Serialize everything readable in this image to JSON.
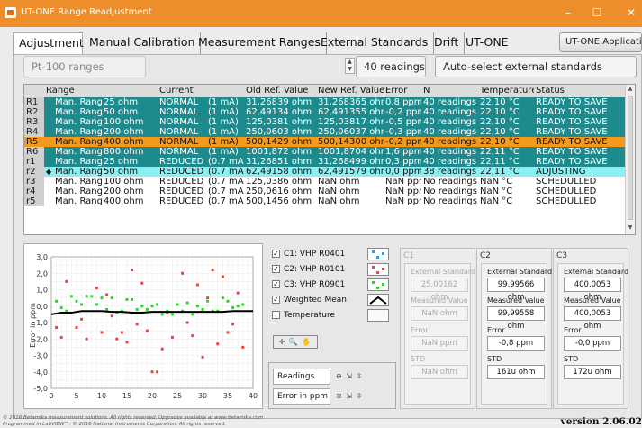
{
  "window": {
    "title": "UT-ONE Range Readjustment",
    "minimize": "–",
    "maximize": "☐",
    "close": "✕"
  },
  "tabs": [
    "Adjustment",
    "Manual Calibration",
    "Measurement Ranges",
    "External Standards",
    "Drift",
    "UT-ONE"
  ],
  "app_button": "UT-ONE Application",
  "controls": {
    "range_set": "Pt-100 ranges",
    "readings": "40 readings",
    "auto_select": "Auto-select external standards"
  },
  "table": {
    "headers": [
      "",
      "Range",
      "",
      "Current",
      "",
      "Old Ref. Value",
      "New Ref. Value",
      "Error",
      "N",
      "Temperature",
      "Status"
    ],
    "rows": [
      {
        "id": "R1",
        "range": "Man. Range",
        "val": "25 ohm",
        "cur": "NORMAL",
        "ma": "(1 mA)",
        "old": "31,26839 ohm",
        "new": "31,268365 ohm",
        "err": "0,8 ppm",
        "n": "40 readings",
        "temp": "22,10 °C",
        "status": "READY TO SAVE",
        "style": "teal",
        "mark": ""
      },
      {
        "id": "R2",
        "range": "Man. Range",
        "val": "50 ohm",
        "cur": "NORMAL",
        "ma": "(1 mA)",
        "old": "62,49134 ohm",
        "new": "62,491355 ohm",
        "err": "-0,2 ppm",
        "n": "40 readings",
        "temp": "22,10 °C",
        "status": "READY TO SAVE",
        "style": "teal",
        "mark": ""
      },
      {
        "id": "R3",
        "range": "Man. Range",
        "val": "100 ohm",
        "cur": "NORMAL",
        "ma": "(1 mA)",
        "old": "125,0381 ohm",
        "new": "125,03817 ohm",
        "err": "-0,5 ppm",
        "n": "40 readings",
        "temp": "22,10 °C",
        "status": "READY TO SAVE",
        "style": "teal",
        "mark": ""
      },
      {
        "id": "R4",
        "range": "Man. Range",
        "val": "200 ohm",
        "cur": "NORMAL",
        "ma": "(1 mA)",
        "old": "250,0603 ohm",
        "new": "250,06037 ohm",
        "err": "-0,3 ppm",
        "n": "40 readings",
        "temp": "22,10 °C",
        "status": "READY TO SAVE",
        "style": "teal",
        "mark": ""
      },
      {
        "id": "R5",
        "range": "Man. Range",
        "val": "400 ohm",
        "cur": "NORMAL",
        "ma": "(1 mA)",
        "old": "500,1429 ohm",
        "new": "500,14300 ohm",
        "err": "-0,2 ppm",
        "n": "40 readings",
        "temp": "22,10 °C",
        "status": "READY TO SAVE",
        "style": "orange",
        "mark": ""
      },
      {
        "id": "R6",
        "range": "Man. Range",
        "val": "800 ohm",
        "cur": "NORMAL",
        "ma": "(1 mA)",
        "old": "1001,872 ohm",
        "new": "1001,8704 ohm",
        "err": "1,6 ppm",
        "n": "40 readings",
        "temp": "22,11 °C",
        "status": "READY TO SAVE",
        "style": "teal",
        "mark": ""
      },
      {
        "id": "r1",
        "range": "Man. Range",
        "val": "25 ohm",
        "cur": "REDUCED",
        "ma": "(0.7 mA)",
        "old": "31,26851 ohm",
        "new": "31,268499 ohm",
        "err": "0,3 ppm",
        "n": "40 readings",
        "temp": "22,11 °C",
        "status": "READY TO SAVE",
        "style": "teal",
        "mark": ""
      },
      {
        "id": "r2",
        "range": "Man. Range",
        "val": "50 ohm",
        "cur": "REDUCED",
        "ma": "(0.7 mA)",
        "old": "62,49158 ohm",
        "new": "62,491579 ohm",
        "err": "0,0 ppm",
        "n": "38 readings",
        "temp": "22,11 °C",
        "status": "ADJUSTING",
        "style": "cyan",
        "mark": "◆"
      },
      {
        "id": "r3",
        "range": "Man. Range",
        "val": "100 ohm",
        "cur": "REDUCED",
        "ma": "(0.7 mA)",
        "old": "125,0386 ohm",
        "new": "NaN ohm",
        "err": "NaN ppm",
        "n": "No readings",
        "temp": "NaN °C",
        "status": "SCHEDULLED",
        "style": "plain",
        "mark": ""
      },
      {
        "id": "r4",
        "range": "Man. Range",
        "val": "200 ohm",
        "cur": "REDUCED",
        "ma": "(0.7 mA)",
        "old": "250,0616 ohm",
        "new": "NaN ohm",
        "err": "NaN ppm",
        "n": "No readings",
        "temp": "NaN °C",
        "status": "SCHEDULLED",
        "style": "plain",
        "mark": ""
      },
      {
        "id": "r5",
        "range": "Man. Range",
        "val": "400 ohm",
        "cur": "REDUCED",
        "ma": "(0.7 mA)",
        "old": "500,1456 ohm",
        "new": "NaN ohm",
        "err": "NaN ppm",
        "n": "No readings",
        "temp": "NaN °C",
        "status": "SCHEDULLED",
        "style": "plain",
        "mark": ""
      }
    ]
  },
  "legend": [
    {
      "label": "C1: VHP R0401",
      "checked": true,
      "color": "#3a9ad9"
    },
    {
      "label": "C2: VHP R0101",
      "checked": true,
      "color": "#e94545"
    },
    {
      "label": "C3: VHP R0901",
      "checked": true,
      "color": "#2ed42e"
    },
    {
      "label": "Weighted Mean",
      "checked": true,
      "color": "#000000"
    },
    {
      "label": "Temperature",
      "checked": false,
      "color": ""
    }
  ],
  "plot_tools": "✛ 🔍 ✋",
  "bottom_fields": {
    "readings": "Readings",
    "error": "Error in ppm",
    "icons": "⊕ ⇲ ⇳"
  },
  "channels": [
    {
      "cap": "C1",
      "disabled": true,
      "ext_label": "External Standard",
      "ext": "25,00162 ohm",
      "meas_label": "Measured Value",
      "meas": "NaN ohm",
      "err_label": "Error",
      "err": "NaN ppm",
      "std_label": "STD",
      "std": "NaN ohm"
    },
    {
      "cap": "C2",
      "disabled": false,
      "ext_label": "External Standard",
      "ext": "99,99566 ohm",
      "meas_label": "Measured Value",
      "meas": "99,99558 ohm",
      "err_label": "Error",
      "err": "-0,8 ppm",
      "std_label": "STD",
      "std": "161u ohm"
    },
    {
      "cap": "C3",
      "disabled": false,
      "ext_label": "External Standard",
      "ext": "400,0053 ohm",
      "meas_label": "Measured Value",
      "meas": "400,0053 ohm",
      "err_label": "Error",
      "err": "-0,0 ppm",
      "std_label": "STD",
      "std": "172u ohm"
    }
  ],
  "footer": {
    "copy1": "© 2016 Betamika measurement solutions. All rights reserved. Upgrades available at www.betamika.com",
    "copy2": "Programmed in LabVIEW™. © 2016 National Instruments Corporation. All rights reserved.",
    "version": "version 2.06.02"
  },
  "chart_data": {
    "type": "scatter",
    "title": "",
    "xlabel": "",
    "ylabel": "Error in ppm",
    "xlim": [
      0,
      40
    ],
    "ylim": [
      -5,
      3
    ],
    "xticks": [
      "0",
      "5",
      "10",
      "15",
      "20",
      "25",
      "30",
      "35",
      "40"
    ],
    "yticks": [
      "3,0",
      "2,0",
      "1,0",
      "0,0",
      "-1,0",
      "-2,0",
      "-3,0",
      "-4,0",
      "-5,0"
    ],
    "grid": true,
    "series": [
      {
        "name": "C2: VHP R0101",
        "color": "#e94545",
        "marker": "square",
        "x": [
          1,
          2,
          3,
          5,
          6,
          7,
          9,
          10,
          11,
          12,
          13,
          14,
          15,
          16,
          17,
          18,
          19,
          20,
          21,
          22,
          23,
          24,
          26,
          27,
          28,
          29,
          30,
          31,
          32,
          33,
          34,
          35,
          36,
          37,
          38
        ],
        "y": [
          -1.3,
          -1.9,
          1.5,
          -1.3,
          -0.8,
          -2.0,
          1.1,
          -1.6,
          0.7,
          -0.6,
          -2.0,
          -1.6,
          -2.2,
          2.2,
          -1.1,
          1.4,
          -1.5,
          -4.0,
          -4.0,
          -2.6,
          -0.4,
          -1.9,
          2.0,
          -1.0,
          -1.8,
          1.3,
          -3.1,
          0.5,
          2.2,
          -2.3,
          1.8,
          -1.6,
          -1.1,
          0.8,
          -2.5
        ]
      },
      {
        "name": "C3: VHP R0901",
        "color": "#2ed42e",
        "marker": "square",
        "x": [
          1,
          2,
          3,
          4,
          5,
          6,
          7,
          8,
          9,
          10,
          11,
          12,
          13,
          14,
          15,
          16,
          17,
          18,
          19,
          20,
          21,
          22,
          23,
          24,
          25,
          26,
          27,
          28,
          29,
          30,
          31,
          32,
          33,
          34,
          35,
          36,
          37,
          38
        ],
        "y": [
          0.3,
          -0.1,
          -0.3,
          0.6,
          0.3,
          0.1,
          0.6,
          0.6,
          0.1,
          0.5,
          -0.2,
          0.5,
          -0.4,
          -0.3,
          0.4,
          0.4,
          -0.2,
          0.0,
          -0.2,
          0.0,
          0.1,
          -0.5,
          -0.3,
          -0.5,
          0.1,
          -0.3,
          0.2,
          -0.5,
          0.0,
          -0.2,
          0.3,
          -0.3,
          -0.3,
          0.5,
          0.3,
          -0.1,
          0.0,
          0.1
        ]
      },
      {
        "name": "Weighted Mean",
        "color": "#000000",
        "marker": "line",
        "x": [
          0,
          2,
          4,
          6,
          8,
          10,
          12,
          14,
          16,
          18,
          20,
          22,
          24,
          26,
          28,
          30,
          32,
          34,
          36,
          38,
          40
        ],
        "y": [
          -0.5,
          -0.4,
          -0.4,
          -0.3,
          -0.3,
          -0.3,
          -0.35,
          -0.35,
          -0.4,
          -0.4,
          -0.35,
          -0.35,
          -0.35,
          -0.35,
          -0.35,
          -0.35,
          -0.35,
          -0.35,
          -0.3,
          -0.3,
          -0.3
        ]
      }
    ]
  }
}
